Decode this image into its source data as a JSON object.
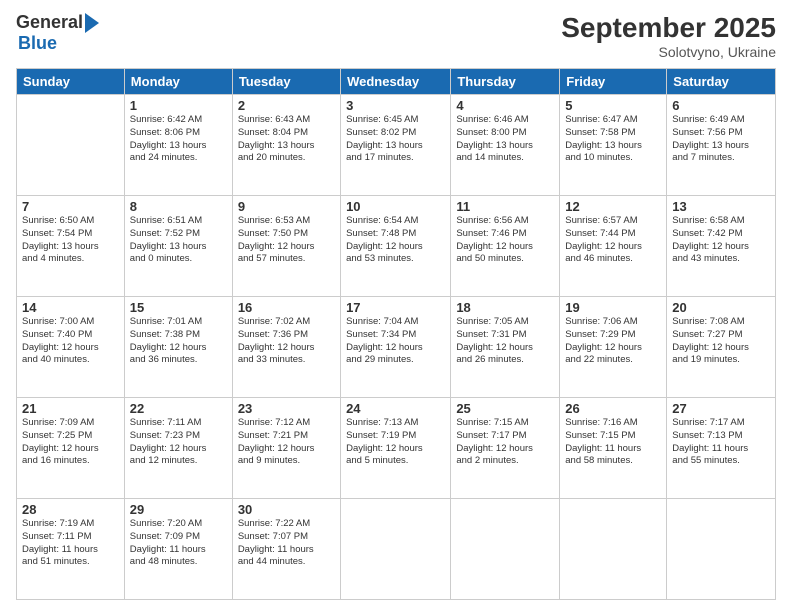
{
  "logo": {
    "general": "General",
    "blue": "Blue"
  },
  "header": {
    "month": "September 2025",
    "location": "Solotvyno, Ukraine"
  },
  "days_of_week": [
    "Sunday",
    "Monday",
    "Tuesday",
    "Wednesday",
    "Thursday",
    "Friday",
    "Saturday"
  ],
  "weeks": [
    [
      {
        "day": "",
        "info": ""
      },
      {
        "day": "1",
        "info": "Sunrise: 6:42 AM\nSunset: 8:06 PM\nDaylight: 13 hours\nand 24 minutes."
      },
      {
        "day": "2",
        "info": "Sunrise: 6:43 AM\nSunset: 8:04 PM\nDaylight: 13 hours\nand 20 minutes."
      },
      {
        "day": "3",
        "info": "Sunrise: 6:45 AM\nSunset: 8:02 PM\nDaylight: 13 hours\nand 17 minutes."
      },
      {
        "day": "4",
        "info": "Sunrise: 6:46 AM\nSunset: 8:00 PM\nDaylight: 13 hours\nand 14 minutes."
      },
      {
        "day": "5",
        "info": "Sunrise: 6:47 AM\nSunset: 7:58 PM\nDaylight: 13 hours\nand 10 minutes."
      },
      {
        "day": "6",
        "info": "Sunrise: 6:49 AM\nSunset: 7:56 PM\nDaylight: 13 hours\nand 7 minutes."
      }
    ],
    [
      {
        "day": "7",
        "info": "Sunrise: 6:50 AM\nSunset: 7:54 PM\nDaylight: 13 hours\nand 4 minutes."
      },
      {
        "day": "8",
        "info": "Sunrise: 6:51 AM\nSunset: 7:52 PM\nDaylight: 13 hours\nand 0 minutes."
      },
      {
        "day": "9",
        "info": "Sunrise: 6:53 AM\nSunset: 7:50 PM\nDaylight: 12 hours\nand 57 minutes."
      },
      {
        "day": "10",
        "info": "Sunrise: 6:54 AM\nSunset: 7:48 PM\nDaylight: 12 hours\nand 53 minutes."
      },
      {
        "day": "11",
        "info": "Sunrise: 6:56 AM\nSunset: 7:46 PM\nDaylight: 12 hours\nand 50 minutes."
      },
      {
        "day": "12",
        "info": "Sunrise: 6:57 AM\nSunset: 7:44 PM\nDaylight: 12 hours\nand 46 minutes."
      },
      {
        "day": "13",
        "info": "Sunrise: 6:58 AM\nSunset: 7:42 PM\nDaylight: 12 hours\nand 43 minutes."
      }
    ],
    [
      {
        "day": "14",
        "info": "Sunrise: 7:00 AM\nSunset: 7:40 PM\nDaylight: 12 hours\nand 40 minutes."
      },
      {
        "day": "15",
        "info": "Sunrise: 7:01 AM\nSunset: 7:38 PM\nDaylight: 12 hours\nand 36 minutes."
      },
      {
        "day": "16",
        "info": "Sunrise: 7:02 AM\nSunset: 7:36 PM\nDaylight: 12 hours\nand 33 minutes."
      },
      {
        "day": "17",
        "info": "Sunrise: 7:04 AM\nSunset: 7:34 PM\nDaylight: 12 hours\nand 29 minutes."
      },
      {
        "day": "18",
        "info": "Sunrise: 7:05 AM\nSunset: 7:31 PM\nDaylight: 12 hours\nand 26 minutes."
      },
      {
        "day": "19",
        "info": "Sunrise: 7:06 AM\nSunset: 7:29 PM\nDaylight: 12 hours\nand 22 minutes."
      },
      {
        "day": "20",
        "info": "Sunrise: 7:08 AM\nSunset: 7:27 PM\nDaylight: 12 hours\nand 19 minutes."
      }
    ],
    [
      {
        "day": "21",
        "info": "Sunrise: 7:09 AM\nSunset: 7:25 PM\nDaylight: 12 hours\nand 16 minutes."
      },
      {
        "day": "22",
        "info": "Sunrise: 7:11 AM\nSunset: 7:23 PM\nDaylight: 12 hours\nand 12 minutes."
      },
      {
        "day": "23",
        "info": "Sunrise: 7:12 AM\nSunset: 7:21 PM\nDaylight: 12 hours\nand 9 minutes."
      },
      {
        "day": "24",
        "info": "Sunrise: 7:13 AM\nSunset: 7:19 PM\nDaylight: 12 hours\nand 5 minutes."
      },
      {
        "day": "25",
        "info": "Sunrise: 7:15 AM\nSunset: 7:17 PM\nDaylight: 12 hours\nand 2 minutes."
      },
      {
        "day": "26",
        "info": "Sunrise: 7:16 AM\nSunset: 7:15 PM\nDaylight: 11 hours\nand 58 minutes."
      },
      {
        "day": "27",
        "info": "Sunrise: 7:17 AM\nSunset: 7:13 PM\nDaylight: 11 hours\nand 55 minutes."
      }
    ],
    [
      {
        "day": "28",
        "info": "Sunrise: 7:19 AM\nSunset: 7:11 PM\nDaylight: 11 hours\nand 51 minutes."
      },
      {
        "day": "29",
        "info": "Sunrise: 7:20 AM\nSunset: 7:09 PM\nDaylight: 11 hours\nand 48 minutes."
      },
      {
        "day": "30",
        "info": "Sunrise: 7:22 AM\nSunset: 7:07 PM\nDaylight: 11 hours\nand 44 minutes."
      },
      {
        "day": "",
        "info": ""
      },
      {
        "day": "",
        "info": ""
      },
      {
        "day": "",
        "info": ""
      },
      {
        "day": "",
        "info": ""
      }
    ]
  ]
}
